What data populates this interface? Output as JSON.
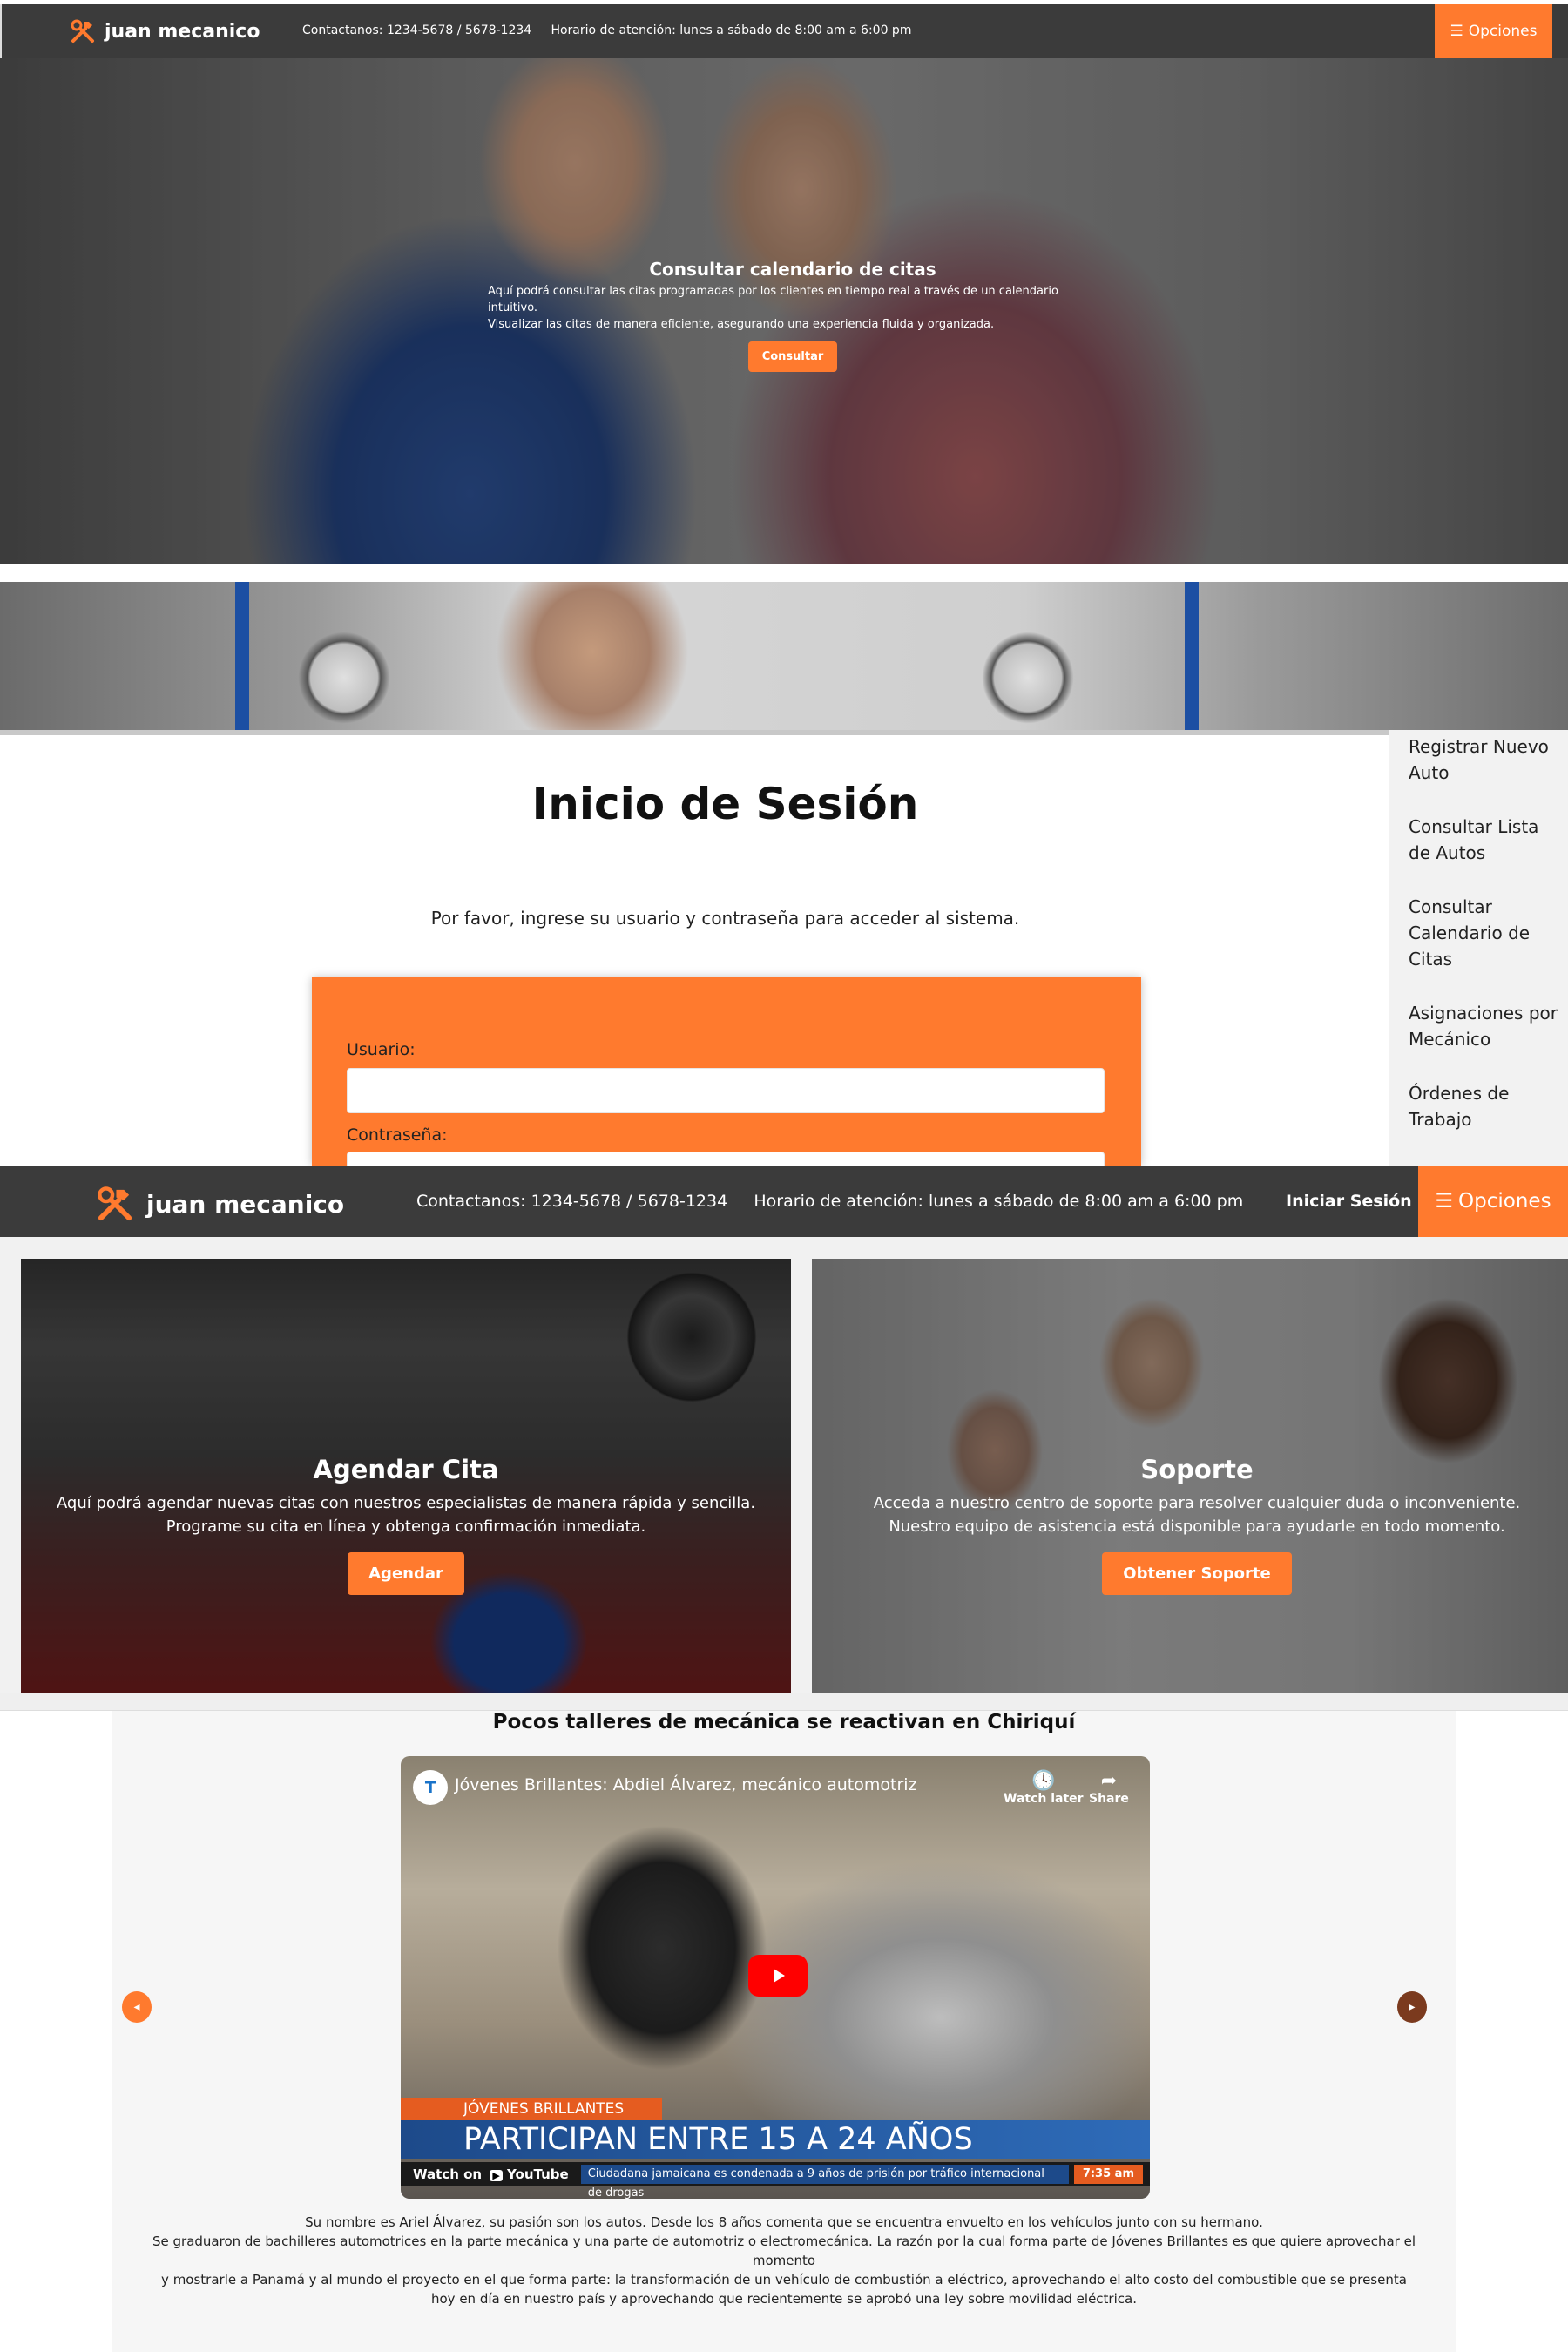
{
  "header_small": {
    "brand": "juan mecanico",
    "contact": "Contactanos: 1234-5678 / 5678-1234",
    "hours": "Horario de atención: lunes a sábado de 8:00 am a 6:00 pm",
    "options_label": "Opciones"
  },
  "hero": {
    "title": "Consultar calendario de citas",
    "desc_line1": "Aquí podrá consultar las citas programadas por los clientes en tiempo real a través de un calendario intuitivo.",
    "desc_line2": "Visualizar las citas de manera eficiente, asegurando una experiencia fluida y organizada.",
    "button": "Consultar"
  },
  "login": {
    "title": "Inicio de Sesión",
    "subtitle": "Por favor, ingrese su usuario y contraseña para acceder al sistema.",
    "user_label": "Usuario:",
    "user_value": "",
    "password_label": "Contraseña:",
    "password_value": ""
  },
  "side_menu": {
    "items": [
      {
        "label": "Registrar Nuevo Auto"
      },
      {
        "label": "Consultar Lista de Autos"
      },
      {
        "label": "Consultar Calendario de Citas"
      },
      {
        "label": "Asignaciones por Mecánico"
      },
      {
        "label": "Órdenes de Trabajo"
      }
    ]
  },
  "header_large": {
    "brand": "juan mecanico",
    "contact": "Contactanos: 1234-5678 / 5678-1234",
    "hours": "Horario de atención: lunes a sábado de 8:00 am a 6:00 pm",
    "login_link": "Iniciar Sesión",
    "options_label": "Opciones"
  },
  "cards": [
    {
      "title": "Agendar Cita",
      "line1": "Aquí podrá agendar nuevas citas con nuestros especialistas de manera rápida y sencilla.",
      "line2": "Programe su cita en línea y obtenga confirmación inmediata.",
      "button": "Agendar"
    },
    {
      "title": "Soporte",
      "line1": "Acceda a nuestro centro de soporte para resolver cualquier duda o inconveniente.",
      "line2": "Nuestro equipo de asistencia está disponible para ayudarle en todo momento.",
      "button": "Obtener Soporte"
    }
  ],
  "news": {
    "title": "Pocos talleres de mecánica se reactivan en Chiriquí",
    "video": {
      "channel_letter": "T",
      "title": "Jóvenes Brillantes: Abdiel Álvarez, mecánico automotriz",
      "watch_later": "Watch later",
      "share": "Share",
      "banner_small": "JÓVENES BRILLANTES",
      "banner_large": "PARTICIPAN ENTRE 15 A 24 AÑOS",
      "watch_on": "Watch on",
      "youtube": "YouTube",
      "ticker": "Ciudadana jamaicana es condenada a 9 años de prisión por tráfico internacional de drogas",
      "time": "7:35 am"
    },
    "prev_label": "◂",
    "next_label": "▸",
    "paragraph": [
      "Su nombre es Ariel Álvarez, su pasión son los autos. Desde los 8 años comenta que se encuentra envuelto en los vehículos junto con su hermano.",
      "Se graduaron de bachilleres automotrices en la parte mecánica y una parte de automotriz o electromecánica. La razón por la cual forma parte de Jóvenes Brillantes es que quiere aprovechar el momento",
      "y mostrarle a Panamá y al mundo el proyecto en el que forma parte: la transformación de un vehículo de combustión a eléctrico, aprovechando el alto costo del combustible que se presenta hoy en día en nuestro país y aprovechando que recientemente se aprobó una ley sobre movilidad eléctrica."
    ]
  },
  "colors": {
    "accent": "#ff7a2e",
    "header_bg": "#3b3b3b"
  }
}
